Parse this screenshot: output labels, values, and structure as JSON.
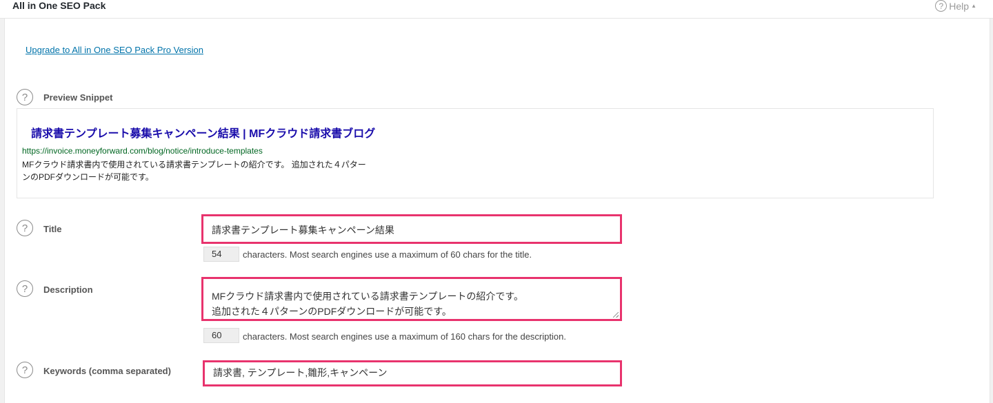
{
  "header": {
    "title": "All in One SEO Pack",
    "help_label": "Help",
    "help_icon": "question-circle-icon",
    "toggle_icon": "triangle-up-icon"
  },
  "upgrade_link": "Upgrade to All in One SEO Pack Pro Version",
  "preview": {
    "label": "Preview Snippet",
    "title": "請求書テンプレート募集キャンペーン結果 | MFクラウド請求書ブログ",
    "url": "https://invoice.moneyforward.com/blog/notice/introduce-templates",
    "description_line1": "MFクラウド請求書内で使用されている請求書テンプレートの紹介です。 追加された４パター",
    "description_line2": "ンのPDFダウンロードが可能です。",
    "colors": {
      "title": "#1a0dab",
      "url": "#006621"
    }
  },
  "fields": {
    "title": {
      "label": "Title",
      "value": "請求書テンプレート募集キャンペーン結果",
      "count": "54",
      "hint": "characters. Most search engines use a maximum of 60 chars for the title."
    },
    "description": {
      "label": "Description",
      "value_line1": "MFクラウド請求書内で使用されている請求書テンプレートの紹介です。",
      "value_line2": "追加された４パターンのPDFダウンロードが可能です。",
      "count": "60",
      "hint": "characters. Most search engines use a maximum of 160 chars for the description."
    },
    "keywords": {
      "label": "Keywords (comma separated)",
      "value": "請求書, テンプレート,雛形,キャンペーン"
    }
  },
  "colors": {
    "highlight_border": "#e8336d",
    "link": "#0073aa"
  }
}
